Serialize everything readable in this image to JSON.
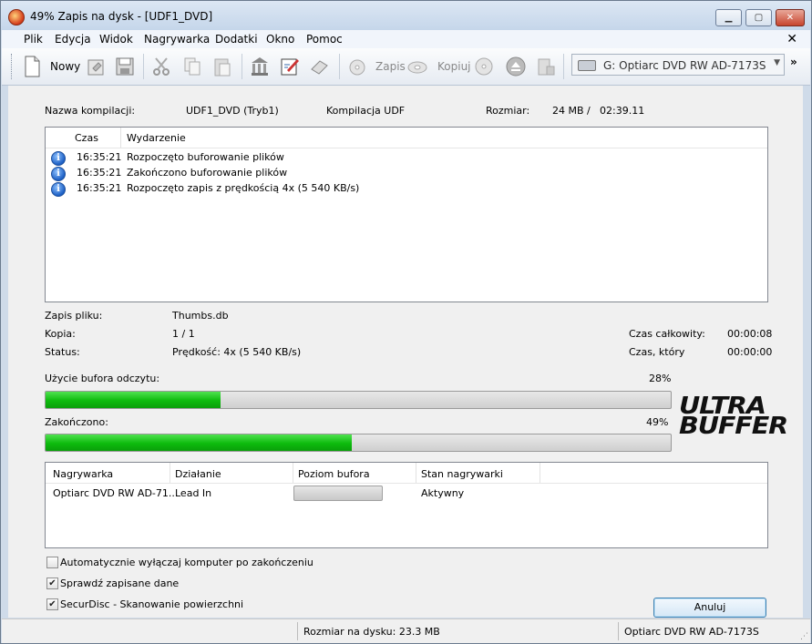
{
  "window": {
    "title": "49% Zapis na dysk - [UDF1_DVD]"
  },
  "menubar": {
    "items": [
      "Plik",
      "Edycja",
      "Widok",
      "Nagrywarka",
      "Dodatki",
      "Okno",
      "Pomoc"
    ]
  },
  "toolbar": {
    "new_label": "Nowy",
    "burn_label": "Zapis",
    "copy_label": "Kopiuj",
    "drive": "G: Optiarc DVD RW AD-7173S"
  },
  "compilation": {
    "name_label": "Nazwa kompilacji:",
    "name_value": "UDF1_DVD (Tryb1)",
    "type": "Kompilacja UDF",
    "size_label": "Rozmiar:",
    "size_mb": "24 MB",
    "size_sep": "/",
    "size_time": "02:39.11"
  },
  "event_log": {
    "columns": [
      "Czas",
      "Wydarzenie"
    ],
    "rows": [
      {
        "time": "16:35:21",
        "text": "Rozpoczęto buforowanie plików"
      },
      {
        "time": "16:35:21",
        "text": "Zakończono buforowanie plików"
      },
      {
        "time": "16:35:21",
        "text": "Rozpoczęto zapis z prędkością 4x (5 540 KB/s)"
      }
    ]
  },
  "progress": {
    "file_label": "Zapis pliku:",
    "file_value": "Thumbs.db",
    "copy_label": "Kopia:",
    "copy_value": "1 / 1",
    "status_label": "Status:",
    "status_value": "Prędkość: 4x (5 540 KB/s)",
    "total_time_label": "Czas całkowity:",
    "total_time_value": "00:00:08",
    "elapsed_label": "Czas, który",
    "elapsed_value": "00:00:00",
    "buffer_label": "Użycie bufora odczytu:",
    "buffer_percent": "28%",
    "buffer_fraction": 0.28,
    "done_label": "Zakończono:",
    "done_percent": "49%",
    "done_fraction": 0.49
  },
  "logo": {
    "line1": "ULTRA",
    "line2": "BUFFER"
  },
  "drives": {
    "columns": [
      "Nagrywarka",
      "Działanie",
      "Poziom bufora",
      "Stan nagrywarki"
    ],
    "rows": [
      {
        "name": "Optiarc DVD RW AD-71...",
        "action": "Lead In",
        "status": "Aktywny"
      }
    ]
  },
  "options": [
    {
      "label": "Automatycznie wyłączaj komputer po zakończeniu",
      "checked": false
    },
    {
      "label": "Sprawdź zapisane dane",
      "checked": true
    },
    {
      "label": "SecurDisc - Skanowanie powierzchni",
      "checked": true
    }
  ],
  "cancel_label": "Anuluj",
  "statusbar": {
    "disk_size": "Rozmiar na dysku: 23.3 MB",
    "drive": "Optiarc  DVD RW AD-7173S"
  },
  "colors": {
    "progress_fill": "#0dbb0d",
    "title_bg": "#c5d6ea"
  },
  "icons": [
    "new-icon",
    "open-icon",
    "save-icon",
    "cut-icon",
    "copy-icon",
    "paste-icon",
    "library-icon",
    "edit-icon",
    "erase-icon",
    "burn-icon",
    "copy-disc-icon",
    "disc-info-icon",
    "eject-icon",
    "drive-icon"
  ]
}
